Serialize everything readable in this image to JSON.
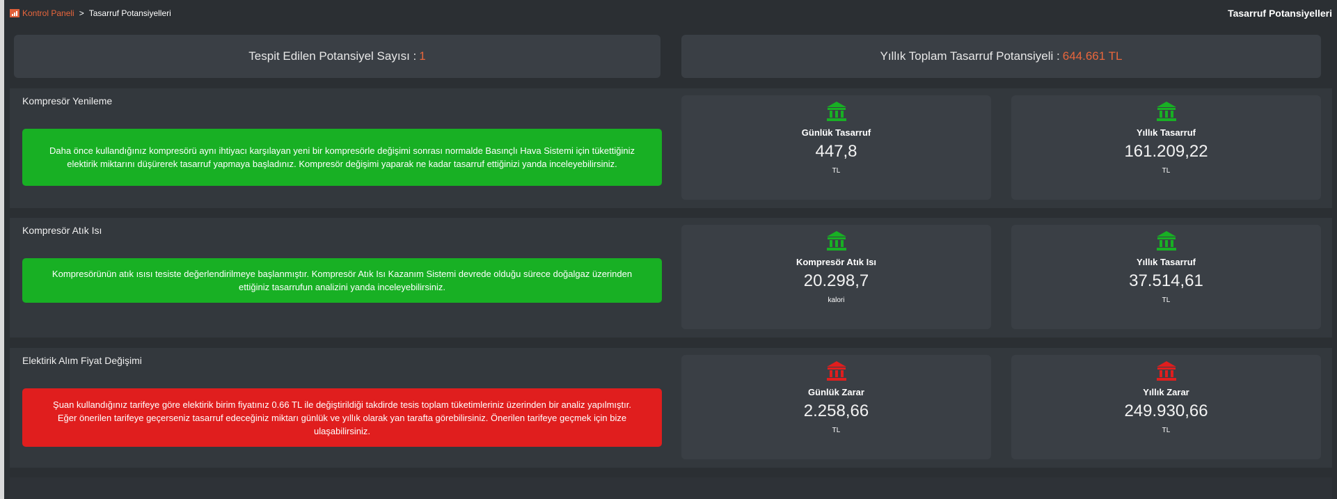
{
  "breadcrumb": {
    "home": "Kontrol Paneli",
    "separator": ">",
    "current": "Tasarruf Potansiyelleri"
  },
  "page_title": "Tasarruf Potansiyelleri",
  "summary": {
    "count_label": "Tespit Edilen Potansiyel Sayısı :",
    "count_value": "1",
    "total_label": "Yıllık Toplam Tasarruf Potansiyeli :",
    "total_value": "644.661 TL"
  },
  "colors": {
    "accent": "#e8663c",
    "positive": "#18b024",
    "negative": "#e01e1e"
  },
  "sections": [
    {
      "title": "Kompresör Yenileme",
      "message": "Daha önce kullandığınız kompresörü aynı ihtiyacı karşılayan yeni bir kompresörle değişimi sonrası normalde Basınçlı Hava Sistemi için tükettiğiniz elektirik miktarını düşürerek tasarruf yapmaya başladınız. Kompresör değişimi yaparak ne kadar tasarruf ettiğinizi yanda inceleyebilirsiniz.",
      "status": "positive",
      "cards": [
        {
          "icon": "bank-icon",
          "label": "Günlük Tasarruf",
          "value": "447,8",
          "unit": "TL"
        },
        {
          "icon": "bank-icon",
          "label": "Yıllık Tasarruf",
          "value": "161.209,22",
          "unit": "TL"
        }
      ]
    },
    {
      "title": "Kompresör Atık Isı",
      "message": "Kompresörünün atık ısısı tesiste değerlendirilmeye başlanmıştır. Kompresör Atık Isı Kazanım Sistemi devrede olduğu sürece doğalgaz üzerinden ettiğiniz tasarrufun analizini yanda inceleyebilirsiniz.",
      "status": "positive",
      "cards": [
        {
          "icon": "bank-icon",
          "label": "Kompresör Atık Isı",
          "value": "20.298,7",
          "unit": "kalori"
        },
        {
          "icon": "bank-icon",
          "label": "Yıllık Tasarruf",
          "value": "37.514,61",
          "unit": "TL"
        }
      ]
    },
    {
      "title": "Elektirik Alım Fiyat Değişimi",
      "message": "Şuan kullandığınız tarifeye göre elektirik birim fiyatınız 0.66 TL ile değiştirildiği takdirde tesis toplam tüketimleriniz üzerinden bir analiz yapılmıştır. Eğer önerilen tarifeye geçerseniz tasarruf edeceğiniz miktarı günlük ve yıllık olarak yan tarafta görebilirsiniz. Önerilen tarifeye geçmek için bize ulaşabilirsiniz.",
      "status": "negative",
      "cards": [
        {
          "icon": "bank-icon",
          "label": "Günlük Zarar",
          "value": "2.258,66",
          "unit": "TL"
        },
        {
          "icon": "bank-icon",
          "label": "Yıllık Zarar",
          "value": "249.930,66",
          "unit": "TL"
        }
      ]
    }
  ]
}
